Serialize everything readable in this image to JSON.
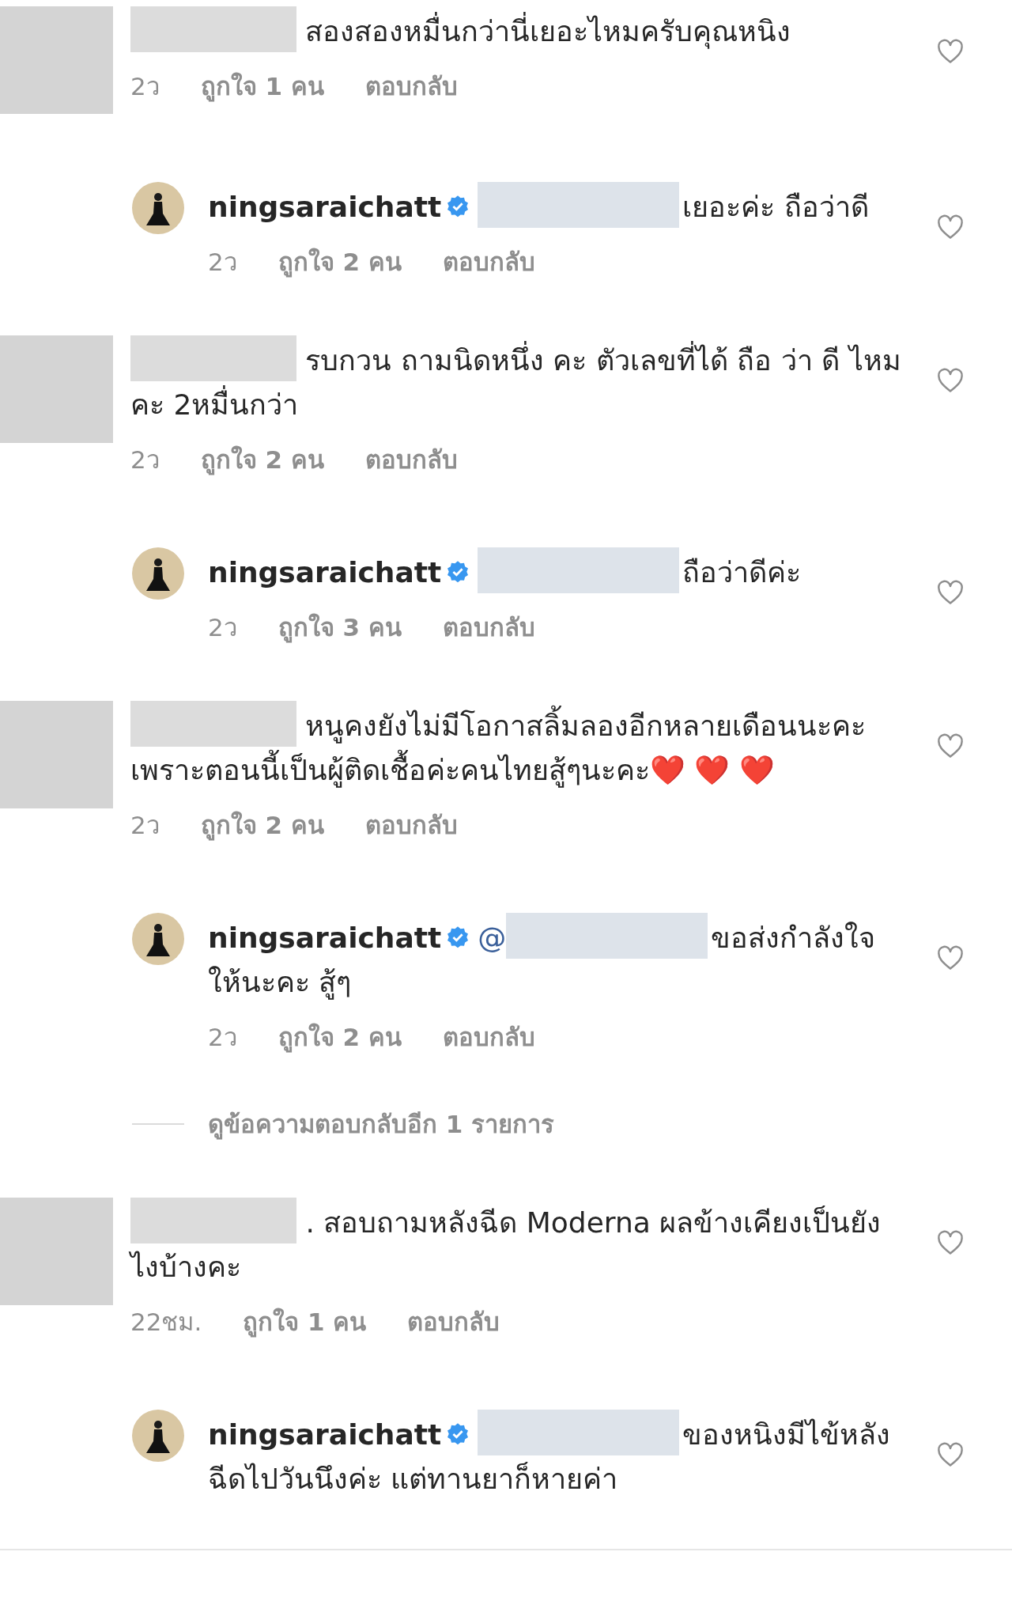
{
  "comments": [
    {
      "kind": "comment",
      "redacted": true,
      "text": "สองสองหมื่นกว่านี่เยอะไหมครับคุณหนิง",
      "time": "2ว",
      "likes": "ถูกใจ 1 คน",
      "reply": "ตอบกลับ"
    },
    {
      "kind": "reply",
      "username": "ningsaraichatt",
      "verified": true,
      "redacted": true,
      "text": "เยอะค่ะ ถือว่าดี",
      "time": "2ว",
      "likes": "ถูกใจ 2 คน",
      "reply": "ตอบกลับ"
    },
    {
      "kind": "comment",
      "redacted": true,
      "text": "รบกวน ถามนิดหนึ่ง คะ ตัวเลขที่ได้ ถือ ว่า ดี ไหมคะ 2หมื่นกว่า",
      "time": "2ว",
      "likes": "ถูกใจ 2 คน",
      "reply": "ตอบกลับ"
    },
    {
      "kind": "reply",
      "username": "ningsaraichatt",
      "verified": true,
      "redacted": true,
      "text": "ถือว่าดีค่ะ",
      "time": "2ว",
      "likes": "ถูกใจ 3 คน",
      "reply": "ตอบกลับ"
    },
    {
      "kind": "comment",
      "redacted": true,
      "text": "หนูคงยังไม่มีโอกาสลิ้มลองอีกหลายเดือนนะคะเพราะตอนนี้เป็นผู้ติดเชื้อค่ะคนไทยสู้ๆนะคะ❤️ ❤️ ❤️",
      "time": "2ว",
      "likes": "ถูกใจ 2 คน",
      "reply": "ตอบกลับ"
    },
    {
      "kind": "reply",
      "username": "ningsaraichatt",
      "verified": true,
      "mention": "@",
      "redacted": true,
      "text": "ขอส่งกำลังใจให้นะคะ สู้ๆ",
      "time": "2ว",
      "likes": "ถูกใจ 2 คน",
      "reply": "ตอบกลับ"
    },
    {
      "kind": "more",
      "text": "ดูข้อความตอบกลับอีก 1 รายการ"
    },
    {
      "kind": "comment",
      "redacted": true,
      "text": ". สอบถามหลังฉีด Moderna ผลข้างเคียงเป็นยังไงบ้างคะ",
      "time": "22ชม.",
      "likes": "ถูกใจ 1 คน",
      "reply": "ตอบกลับ"
    },
    {
      "kind": "reply",
      "username": "ningsaraichatt",
      "verified": true,
      "redacted": true,
      "text": "ของหนิงมีไข้หลังฉีดไปวันนึงค่ะ แต่ทานยาก็หายค่า"
    }
  ]
}
